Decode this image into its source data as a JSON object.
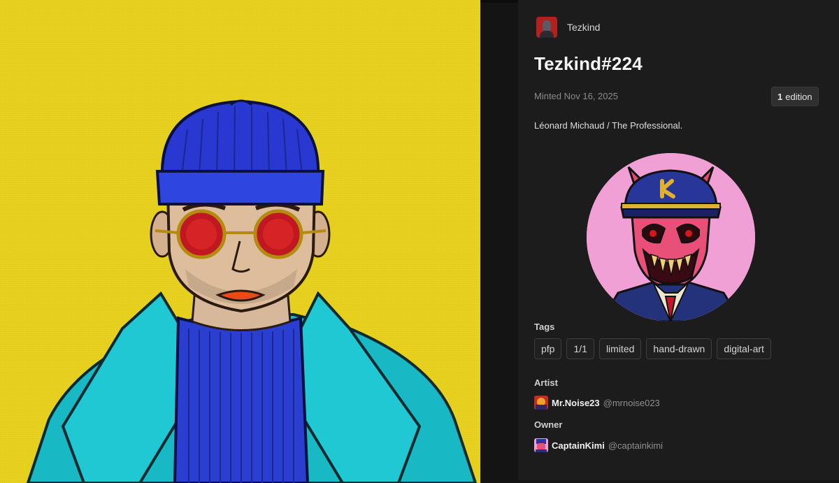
{
  "collection": {
    "name": "Tezkind"
  },
  "token": {
    "title": "Tezkind#224",
    "minted": "Minted Nov 16, 2025",
    "edition_count": "1",
    "edition_word": "edition",
    "description": "Léonard Michaud / The Professional."
  },
  "tags_label": "Tags",
  "tags": [
    "pfp",
    "1/1",
    "limited",
    "hand-drawn",
    "digital-art"
  ],
  "artist": {
    "label": "Artist",
    "name": "Mr.Noise23",
    "handle": "@mrnoise023"
  },
  "owner": {
    "label": "Owner",
    "name": "CaptainKimi",
    "handle": "@captainkimi"
  },
  "colors": {
    "artwork_background": "#e8d21f",
    "panel_background": "#1c1c1c",
    "owner_avatar_background": "#f1a0d6"
  }
}
